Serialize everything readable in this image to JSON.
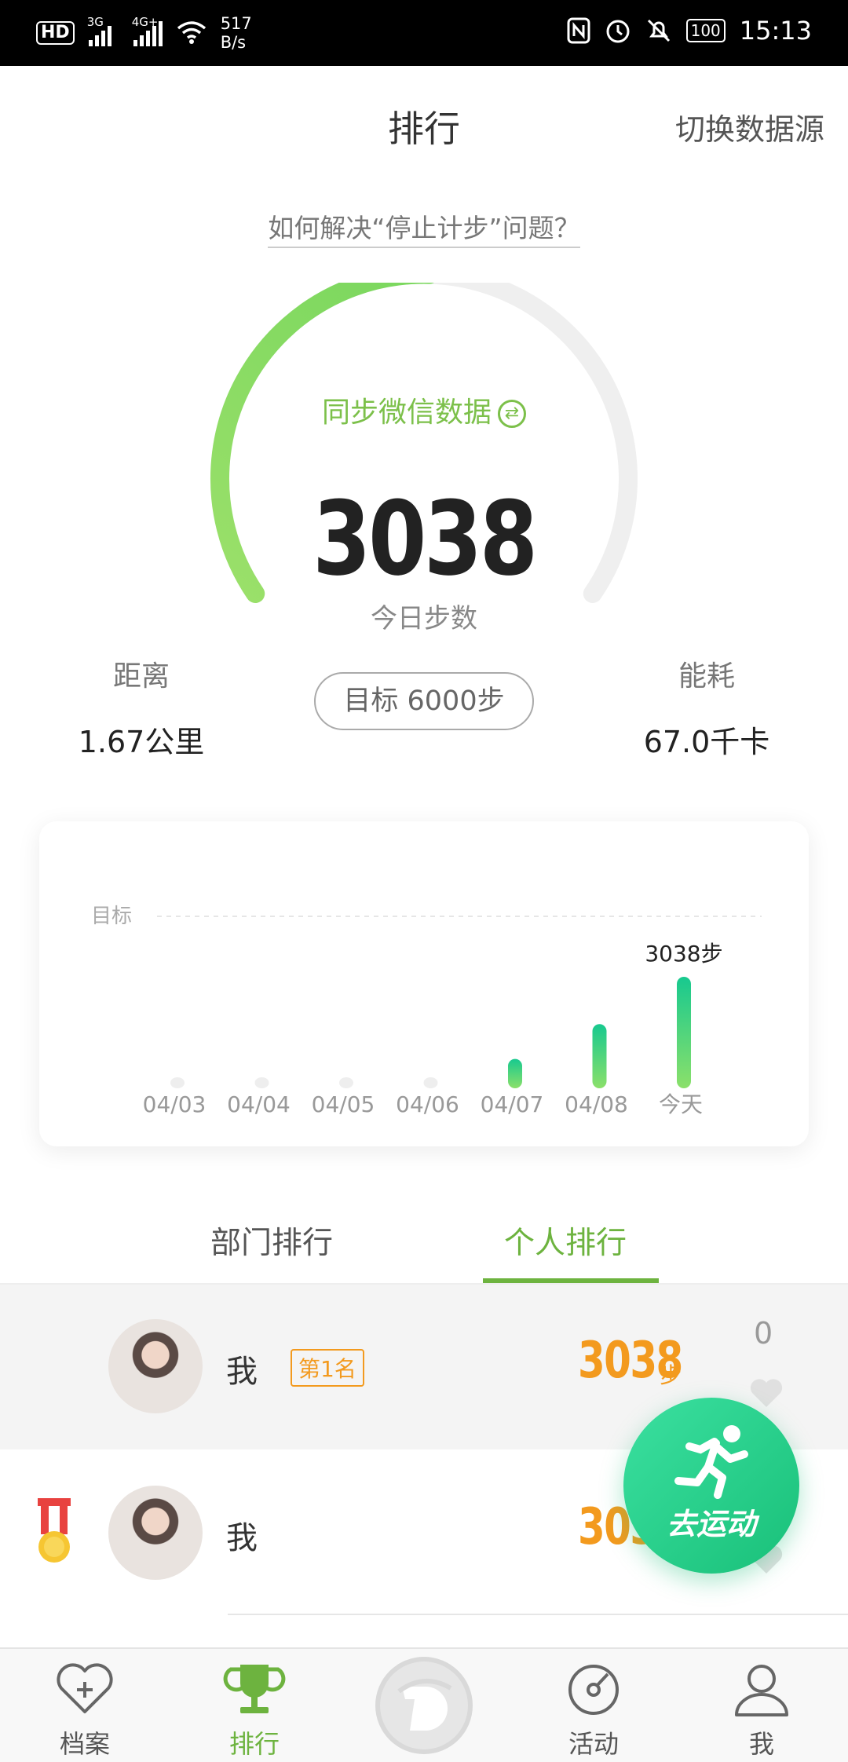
{
  "status_bar": {
    "left_badge": "HD",
    "signal1": "3G",
    "signal2": "4G+",
    "net_speed_value": "517",
    "net_speed_unit": "B/s",
    "battery": "100",
    "time": "15:13"
  },
  "header": {
    "title": "排行",
    "switch_source": "切换数据源"
  },
  "help_link": "如何解决“停止计步”问题？",
  "gauge": {
    "sync_label": "同步微信数据",
    "steps": "3038",
    "steps_label": "今日步数",
    "progress": 0.506,
    "track_color": "#efefef",
    "fill_color": "#7dd858"
  },
  "stats": {
    "distance_label": "距离",
    "distance_value": "1.67公里",
    "goal": "目标 6000步",
    "energy_label": "能耗",
    "energy_value": "67.0千卡"
  },
  "chart_data": {
    "type": "bar",
    "goal_label": "目标",
    "goal_value": 6000,
    "categories": [
      "04/03",
      "04/04",
      "04/05",
      "04/06",
      "04/07",
      "04/08",
      "今天"
    ],
    "values": [
      0,
      0,
      0,
      0,
      800,
      1750,
      3038
    ],
    "highlight_label": "3038步",
    "ylim": [
      0,
      6000
    ]
  },
  "tabs": {
    "department": "部门排行",
    "personal": "个人排行"
  },
  "ranking": [
    {
      "name": "我",
      "rank_badge": "第1名",
      "steps": "3038",
      "unit": "步",
      "likes": "0"
    },
    {
      "name": "我",
      "steps": "3038",
      "unit": "步"
    }
  ],
  "fab_label": "去运动",
  "nav": {
    "archive": "档案",
    "ranking": "排行",
    "activity": "活动",
    "me": "我"
  }
}
